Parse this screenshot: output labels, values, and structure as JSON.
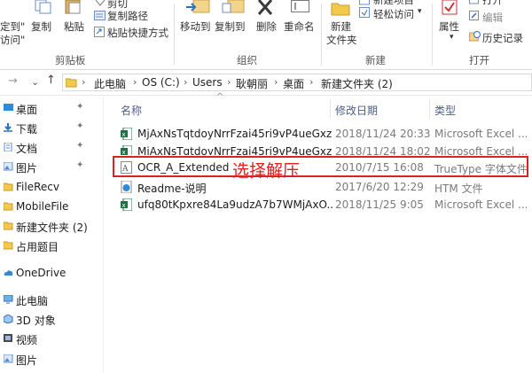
{
  "ribbon": {
    "clipboard": {
      "pin_label_top": "定到\"",
      "pin_label_bottom": "访问\"",
      "copy": "复制",
      "paste": "粘贴",
      "cut": "剪切",
      "copy_path": "复制路径",
      "paste_shortcut": "粘贴快捷方式",
      "group": "剪贴板"
    },
    "organize": {
      "move_to": "移动到",
      "copy_to": "复制到",
      "delete": "删除",
      "rename": "重命名",
      "group": "组织"
    },
    "new": {
      "new_item": "新建项目",
      "easy_access": "轻松访问",
      "new_folder_top": "新建",
      "new_folder_bottom": "文件夹",
      "group": "新建"
    },
    "open": {
      "properties": "属性",
      "open": "打开",
      "edit": "编辑",
      "history": "历史记录",
      "group": "打开"
    }
  },
  "address": {
    "crumbs": [
      "此电脑",
      "OS (C:)",
      "Users",
      "耿朝丽",
      "桌面",
      "新建文件夹 (2)"
    ]
  },
  "nav": {
    "items": [
      {
        "label": "桌面",
        "pinned": true
      },
      {
        "label": "下载",
        "pinned": true
      },
      {
        "label": "文档",
        "pinned": true
      },
      {
        "label": "图片",
        "pinned": true
      },
      {
        "label": "FileRecv",
        "pinned": false
      },
      {
        "label": "MobileFile",
        "pinned": false
      },
      {
        "label": "新建文件夹 (2)",
        "pinned": false
      },
      {
        "label": "占用题目",
        "pinned": false
      },
      {
        "label": "OneDrive",
        "pinned": false
      },
      {
        "label": "此电脑",
        "pinned": false
      },
      {
        "label": "3D 对象",
        "pinned": false
      },
      {
        "label": "视频",
        "pinned": false
      },
      {
        "label": "图片",
        "pinned": false
      }
    ]
  },
  "columns": {
    "name": "名称",
    "modified": "修改日期",
    "type": "类型"
  },
  "files": [
    {
      "name": "MjAxNsTqtdoyNrrFzai45ri9vP4ueGxz...",
      "date": "2018/11/24 20:33",
      "type": "Microsoft Excel ...",
      "icon": "excel"
    },
    {
      "name": "MjAxNsTqtdoyNrrFzai45ri9vP4ueGxz...",
      "date": "2018/11/24 18:02",
      "type": "Microsoft Excel ...",
      "icon": "excel"
    },
    {
      "name": "OCR_A_Extended",
      "date": "2010/7/15 16:08",
      "type": "TrueType 字体文件",
      "icon": "font"
    },
    {
      "name": "Readme-说明",
      "date": "2017/6/20 12:29",
      "type": "HTM 文件",
      "icon": "html"
    },
    {
      "name": "ufq80tKpxre84La9udzA7b7WMjAxO...",
      "date": "2018/11/25 9:05",
      "type": "Microsoft Excel ...",
      "icon": "excel"
    }
  ],
  "annotation": "选择解压",
  "colors": {
    "excel": "#1e7145",
    "folder": "#e9b54a",
    "highlight": "#d92323",
    "header_text": "#4d6082"
  }
}
